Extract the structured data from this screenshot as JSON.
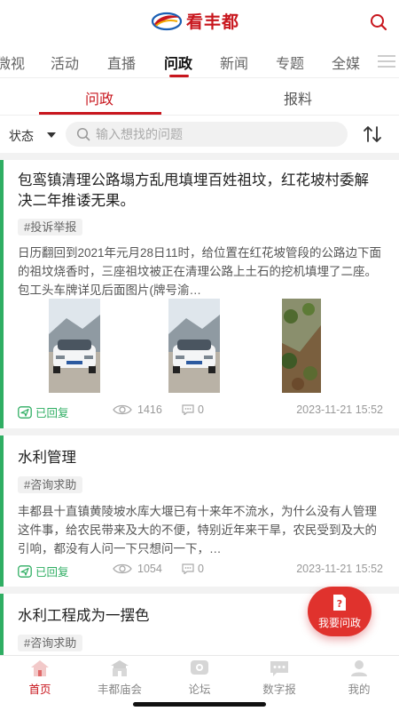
{
  "header": {
    "logo_text": "看丰都",
    "brand_color": "#c8161d",
    "search_icon": "search-icon"
  },
  "channels": [
    "微视",
    "活动",
    "直播",
    "问政",
    "新闻",
    "专题",
    "全媒"
  ],
  "active_channel": "问政",
  "subtabs": {
    "left": "问政",
    "right": "报料",
    "active": "问政"
  },
  "filter": {
    "status_label": "状态",
    "search_placeholder": "输入想找的问题"
  },
  "cards": [
    {
      "title": "包鸾镇清理公路塌方乱甩填埋百姓祖坟，红花坡村委解决二年推诿无果。",
      "tag": "#投诉举报",
      "body": "日历翻回到2021年元月28日11时，给位置在红花坡管段的公路边下面的祖坟烧香时，三座祖坟被正在清理公路上土石的挖机填埋了二座。包工头车牌详见后面图片(牌号渝…",
      "status": "已回复",
      "views": "1416",
      "comments": "0",
      "date": "2023-11-21 15:52"
    },
    {
      "title": "水利管理",
      "tag": "#咨询求助",
      "body": "丰都县十直镇黄陵坡水库大堰已有十来年不流水，为什么没有人管理这件事，给农民带来及大的不便，特别近年来干旱，农民受到及大的引响，都没有人问一下只想问一下，…",
      "status": "已回复",
      "views": "1054",
      "comments": "0",
      "date": "2023-11-21 15:52"
    },
    {
      "title": "水利工程成为一摆色",
      "tag": "#咨询求助"
    }
  ],
  "fab": {
    "label": "我要问政"
  },
  "bottom_nav": [
    {
      "label": "首页",
      "icon": "home-icon",
      "active": true
    },
    {
      "label": "丰都庙会",
      "icon": "temple-icon",
      "active": false
    },
    {
      "label": "论坛",
      "icon": "forum-icon",
      "active": false
    },
    {
      "label": "数字报",
      "icon": "newspaper-icon",
      "active": false
    },
    {
      "label": "我的",
      "icon": "user-icon",
      "active": false
    }
  ]
}
